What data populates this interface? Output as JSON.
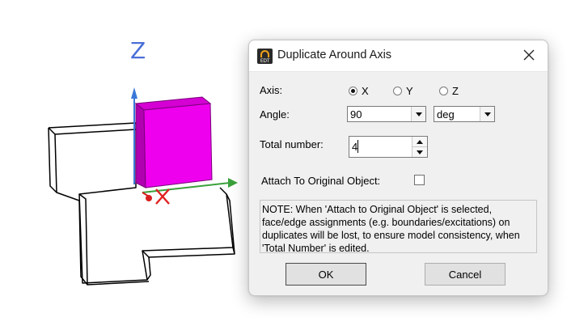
{
  "viewport": {
    "axis_z_label": "Z",
    "axis_x_label": "X",
    "object_color": "#ee00ee"
  },
  "dialog": {
    "title": "Duplicate Around Axis",
    "app_icon_text": "EDT",
    "axis_label": "Axis:",
    "axis_options": [
      {
        "label": "X",
        "selected": true
      },
      {
        "label": "Y",
        "selected": false
      },
      {
        "label": "Z",
        "selected": false
      }
    ],
    "angle_label": "Angle:",
    "angle_value": "90",
    "angle_unit": "deg",
    "total_number_label": "Total number:",
    "total_number_value": "4",
    "attach_label": "Attach To Original Object:",
    "attach_checked": false,
    "note_text": "NOTE:  When 'Attach to Original Object' is selected, face/edge assignments (e.g. boundaries/excitations) on duplicates will be lost, to ensure model consistency, when 'Total Number' is edited.",
    "ok_label": "OK",
    "cancel_label": "Cancel"
  }
}
